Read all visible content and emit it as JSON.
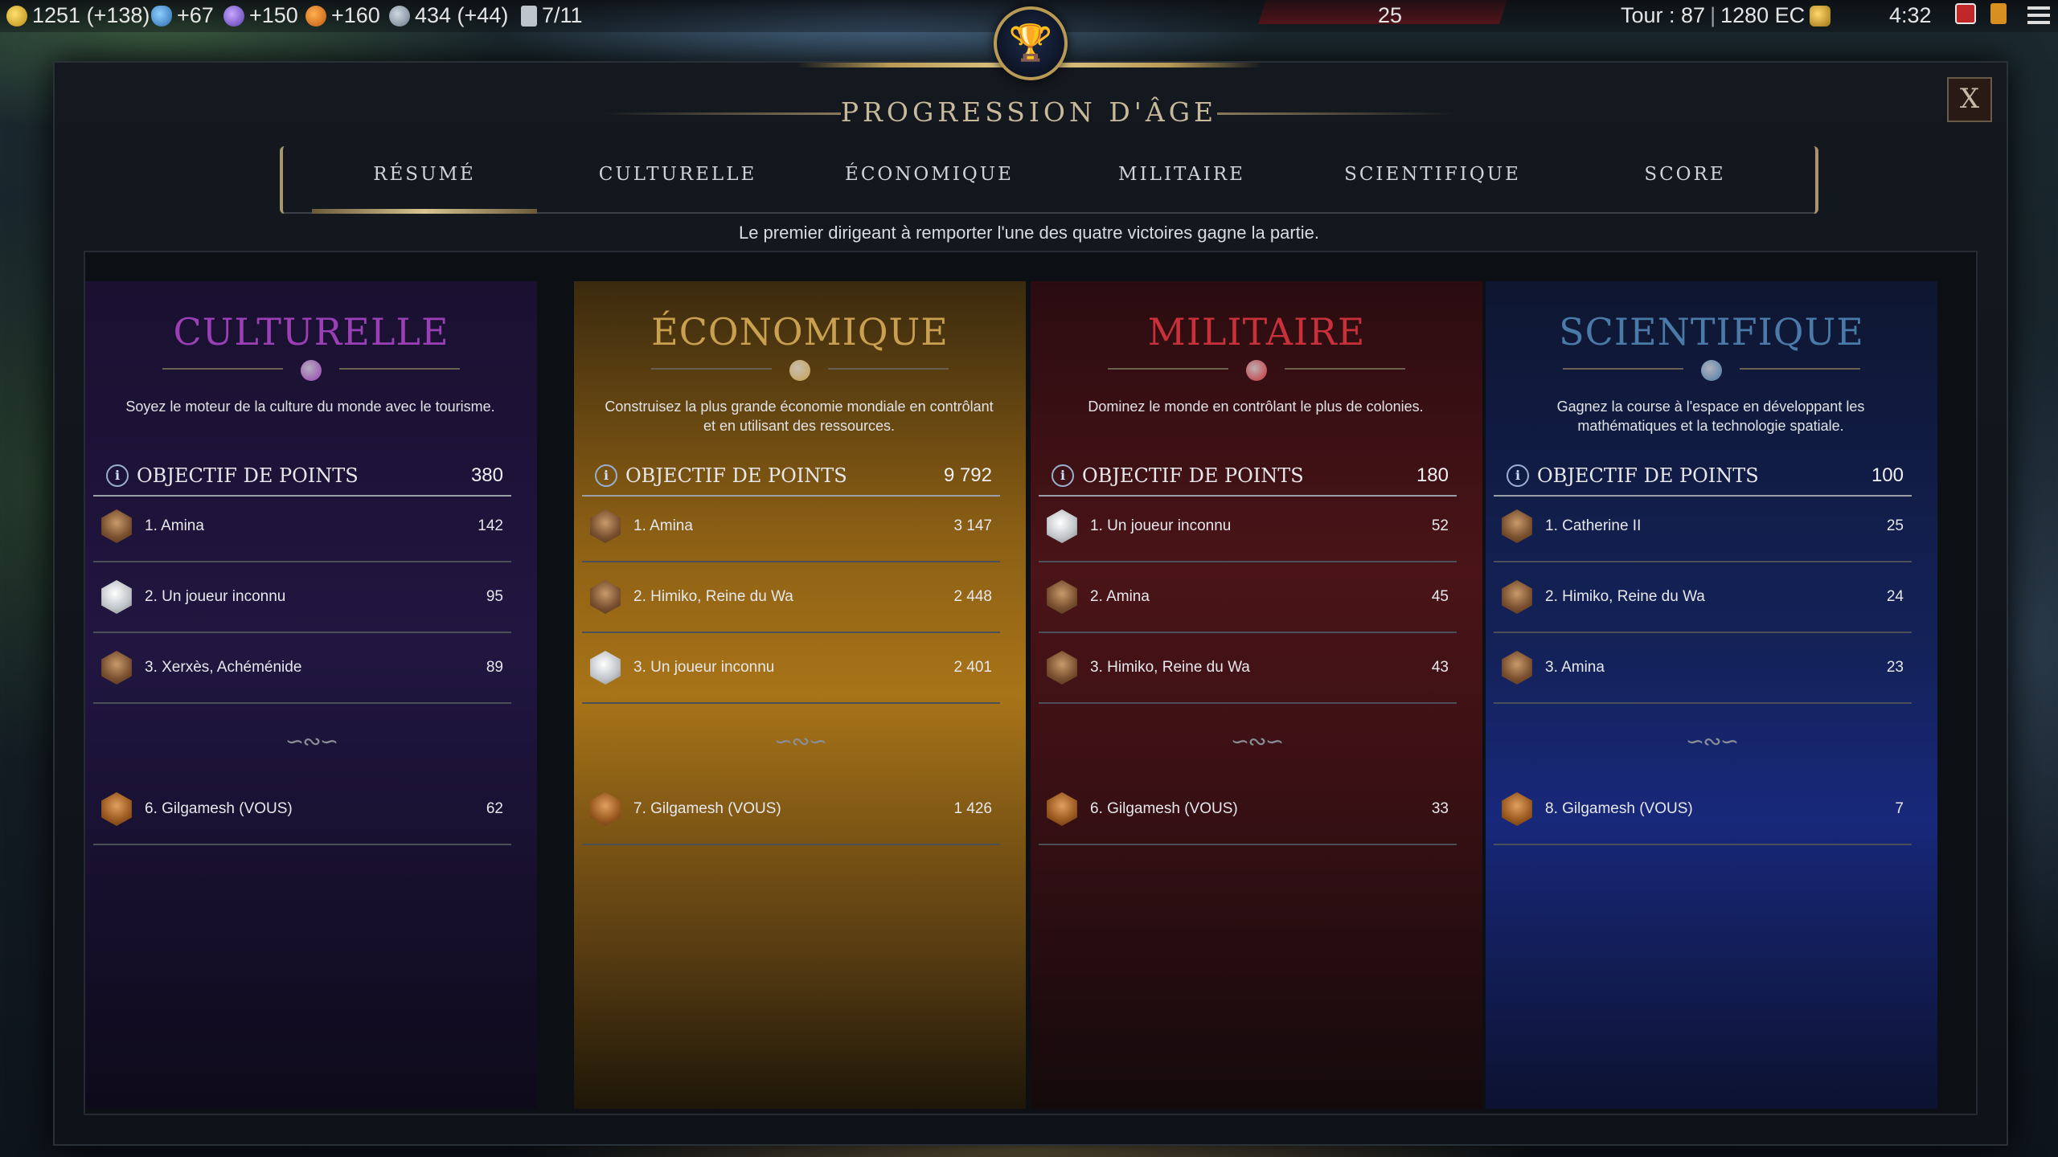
{
  "topbar": {
    "gold": "1251 (+138)",
    "science": "+67",
    "culture": "+150",
    "happiness": "+160",
    "influence": "434 (+44)",
    "settlements": "7/11",
    "center_count": "25",
    "turn": "Tour : 87",
    "year": "1280 EC",
    "clock": "4:32"
  },
  "dialog": {
    "title": "PROGRESSION D'ÂGE",
    "close_label": "X",
    "subtitle": "Le premier dirigeant à remporter l'une des quatre victoires gagne la partie.",
    "tabs": [
      "RÉSUMÉ",
      "CULTURELLE",
      "ÉCONOMIQUE",
      "MILITAIRE",
      "SCIENTIFIQUE",
      "SCORE"
    ],
    "active_tab": "RÉSUMÉ"
  },
  "columns": [
    {
      "key": "cult",
      "title": "CULTURELLE",
      "color": "#9a3fb6",
      "description": "Soyez le moteur de la culture du monde avec le tourisme.",
      "objective_label": "OBJECTIF DE POINTS",
      "objective_value": "380",
      "ranks": [
        {
          "name": "1. Amina",
          "value": "142",
          "avatar": "leader"
        },
        {
          "name": "2. Un joueur inconnu",
          "value": "95",
          "avatar": "unknown"
        },
        {
          "name": "3. Xerxès, Achéménide",
          "value": "89",
          "avatar": "leader"
        }
      ],
      "you": {
        "name": "6. Gilgamesh (VOUS)",
        "value": "62"
      }
    },
    {
      "key": "econ",
      "title": "ÉCONOMIQUE",
      "color": "#c8a050",
      "description": "Construisez la plus grande économie mondiale en contrôlant et en utilisant des ressources.",
      "objective_label": "OBJECTIF DE POINTS",
      "objective_value": "9 792",
      "ranks": [
        {
          "name": "1. Amina",
          "value": "3 147",
          "avatar": "leader"
        },
        {
          "name": "2. Himiko, Reine du Wa",
          "value": "2 448",
          "avatar": "leader"
        },
        {
          "name": "3. Un joueur inconnu",
          "value": "2 401",
          "avatar": "unknown"
        }
      ],
      "you": {
        "name": "7. Gilgamesh (VOUS)",
        "value": "1 426"
      }
    },
    {
      "key": "mil",
      "title": "MILITAIRE",
      "color": "#c8303a",
      "description": "Dominez le monde en contrôlant le plus de colonies.",
      "objective_label": "OBJECTIF DE POINTS",
      "objective_value": "180",
      "ranks": [
        {
          "name": "1. Un joueur inconnu",
          "value": "52",
          "avatar": "unknown"
        },
        {
          "name": "2. Amina",
          "value": "45",
          "avatar": "leader"
        },
        {
          "name": "3. Himiko, Reine du Wa",
          "value": "43",
          "avatar": "leader"
        }
      ],
      "you": {
        "name": "6. Gilgamesh (VOUS)",
        "value": "33"
      }
    },
    {
      "key": "sci",
      "title": "SCIENTIFIQUE",
      "color": "#4a7aa8",
      "description": "Gagnez la course à l'espace en développant les mathématiques et la technologie spatiale.",
      "objective_label": "OBJECTIF DE POINTS",
      "objective_value": "100",
      "ranks": [
        {
          "name": "1. Catherine II",
          "value": "25",
          "avatar": "leader"
        },
        {
          "name": "2. Himiko, Reine du Wa",
          "value": "24",
          "avatar": "leader"
        },
        {
          "name": "3. Amina",
          "value": "23",
          "avatar": "leader"
        }
      ],
      "you": {
        "name": "8. Gilgamesh (VOUS)",
        "value": "7"
      }
    }
  ]
}
